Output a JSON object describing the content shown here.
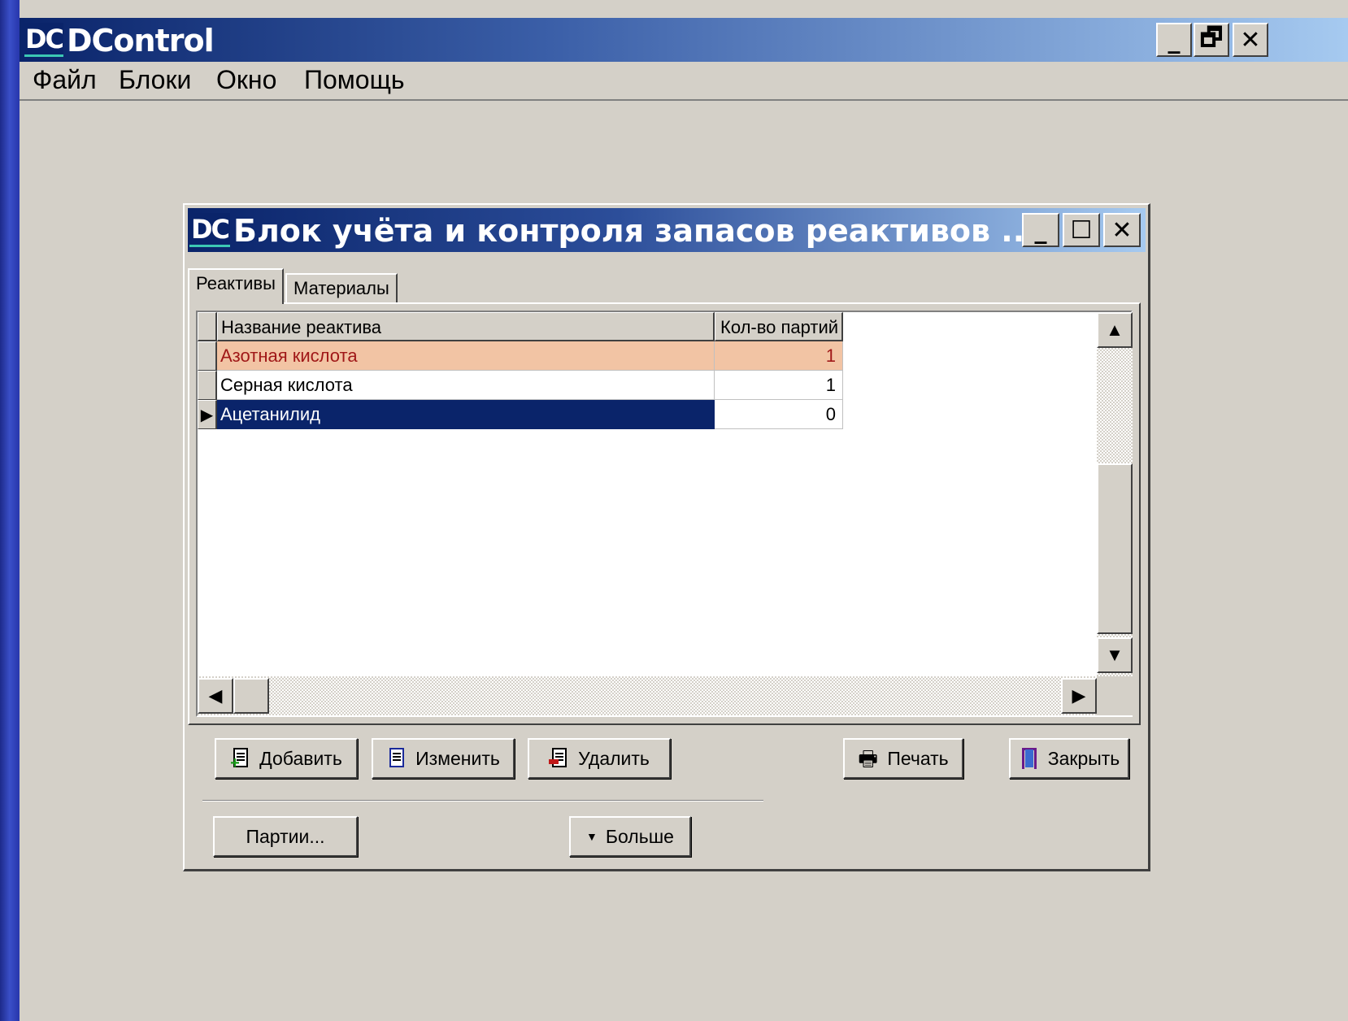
{
  "app": {
    "logo": "DC",
    "title": "DControl",
    "controls": {
      "minimize": "_",
      "restore": "🗗",
      "close": "✕"
    }
  },
  "menu": [
    "Файл",
    "Блоки",
    "Окно",
    "Помощь"
  ],
  "child": {
    "logo": "DC",
    "title": "Блок учёта и контроля запасов реактивов ...",
    "controls": {
      "minimize": "_",
      "maximize": "☐",
      "close": "✕"
    }
  },
  "tabs": [
    {
      "label": "Реактивы",
      "active": true
    },
    {
      "label": "Материалы",
      "active": false
    }
  ],
  "grid": {
    "columns": [
      "Название реактива",
      "Кол-во партий"
    ],
    "rows": [
      {
        "name": "Азотная кислота",
        "count": "1",
        "state": "highlight"
      },
      {
        "name": "Серная кислота",
        "count": "1",
        "state": "normal"
      },
      {
        "name": "Ацетанилид",
        "count": "0",
        "state": "selected"
      }
    ]
  },
  "buttons": {
    "add": "Добавить",
    "edit": "Изменить",
    "delete": "Удалить",
    "print": "Печать",
    "close": "Закрыть",
    "batches": "Партии...",
    "more": "Больше"
  },
  "colors": {
    "highlight_bg": "#f2c4a4",
    "highlight_text": "#a01818",
    "selected_bg": "#0a246a",
    "selected_text": "#ffffff"
  },
  "icons": [
    "add-doc-icon",
    "edit-doc-icon",
    "delete-doc-icon",
    "printer-icon",
    "exit-door-icon",
    "chevron-down-icon"
  ]
}
